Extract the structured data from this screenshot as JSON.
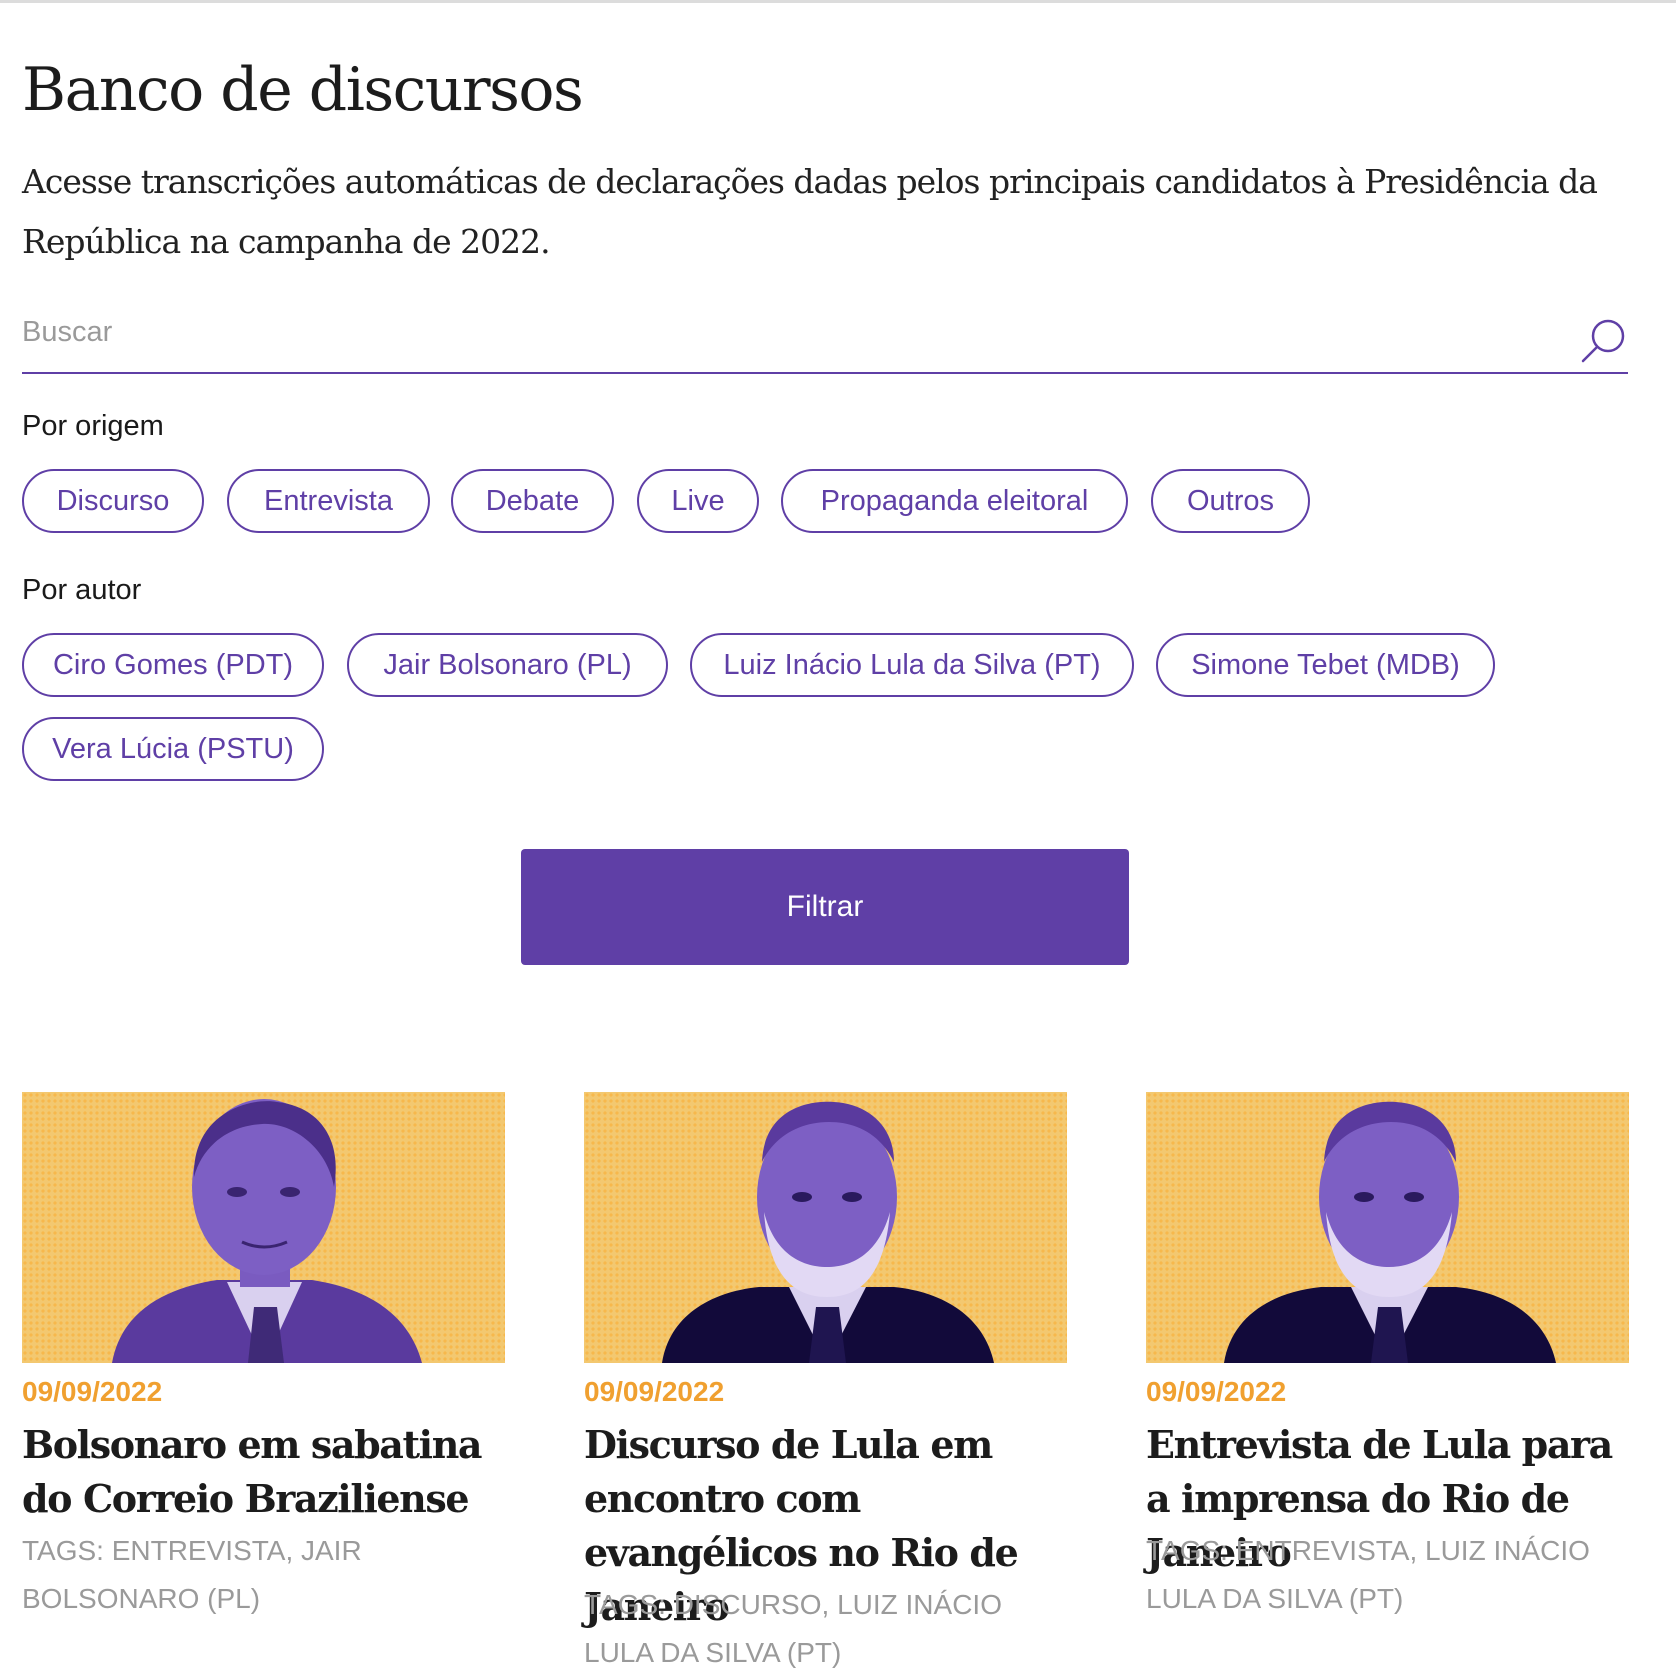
{
  "page": {
    "title": "Banco de discursos",
    "subtitle": "Acesse transcrições automáticas de declarações dadas pelos principais candidatos à Presidência da República na campanha de 2022."
  },
  "search": {
    "placeholder": "Buscar",
    "value": "",
    "icon": "search-icon"
  },
  "filters": {
    "origin": {
      "label": "Por origem",
      "options": [
        "Discurso",
        "Entrevista",
        "Debate",
        "Live",
        "Propaganda eleitoral",
        "Outros"
      ]
    },
    "author": {
      "label": "Por autor",
      "options": [
        "Ciro Gomes (PDT)",
        "Jair Bolsonaro (PL)",
        "Luiz Inácio Lula da Silva (PT)",
        "Simone Tebet (MDB)",
        "Vera Lúcia (PSTU)"
      ]
    },
    "submit_label": "Filtrar"
  },
  "colors": {
    "accent": "#5f3fa6",
    "date": "#f0a030",
    "image_bg": "#f3c870",
    "tags": "#9a9a9a"
  },
  "cards": [
    {
      "date": "09/09/2022",
      "title": "Bolsonaro em sabatina do Correio Braziliense",
      "tags": "TAGS: ENTREVISTA, JAIR BOLSONARO (PL)",
      "image": "bolsonaro-portrait"
    },
    {
      "date": "09/09/2022",
      "title": "Discurso de Lula em encontro com evangélicos no Rio de Janeiro",
      "tags": "TAGS: DISCURSO, LUIZ INÁCIO LULA DA SILVA (PT)",
      "image": "lula-portrait"
    },
    {
      "date": "09/09/2022",
      "title": "Entrevista de Lula para a imprensa do Rio de Janeiro",
      "tags": "TAGS: ENTREVISTA, LUIZ INÁCIO LULA DA SILVA (PT)",
      "image": "lula-portrait"
    }
  ]
}
